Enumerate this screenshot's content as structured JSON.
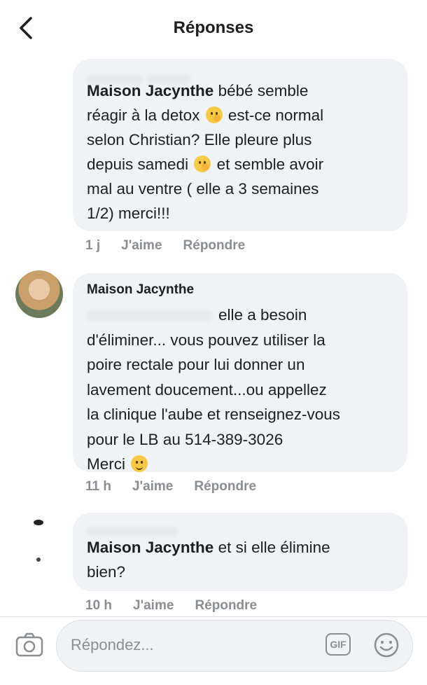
{
  "header": {
    "title": "Réponses",
    "back_icon": "chevron-left-icon"
  },
  "comments": [
    {
      "author": "Maison Jacynthe",
      "text_a": " bébé semble",
      "text_b": "réagir à la detox",
      "text_c": " est-ce normal",
      "text_d": "selon Christian? Elle pleure plus",
      "text_e": "depuis samedi",
      "text_f": " et semble avoir",
      "text_g": "mal au ventre ( elle a 3 semaines",
      "text_h": "1/2) merci!!!",
      "time": "1 j",
      "like": "J'aime",
      "reply": "Répondre"
    },
    {
      "name": "Maison Jacynthe",
      "line1": "elle a besoin",
      "line2": "d'éliminer... vous pouvez utiliser la",
      "line3": "poire rectale pour lui donner un",
      "line4": "lavement doucement...ou appellez",
      "line5": "la clinique l'aube et renseignez-vous",
      "line6": "pour le LB au 514-389-3026",
      "line7": "Merci",
      "time": "11 h",
      "like": "J'aime",
      "reply": "Répondre"
    },
    {
      "author": "Maison Jacynthe",
      "text_a": " et si elle élimine",
      "text_b": "bien?",
      "time": "10 h",
      "like": "J'aime",
      "reply": "Répondre"
    }
  ],
  "composer": {
    "placeholder": "Répondez...",
    "gif_label": "GIF",
    "camera_icon": "camera-icon",
    "emoji_icon": "smiley-icon"
  },
  "colors": {
    "bubble": "#f0f2f5",
    "meta_text": "#8a8d91",
    "text": "#1c1e21"
  }
}
